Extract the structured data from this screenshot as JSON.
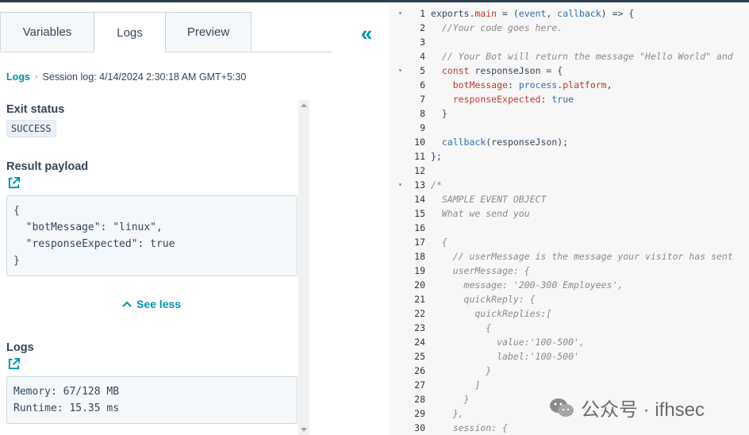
{
  "tabs": [
    {
      "label": "Variables"
    },
    {
      "label": "Logs"
    },
    {
      "label": "Preview"
    }
  ],
  "breadcrumb": {
    "link": "Logs",
    "current": "Session log: 4/14/2024 2:30:18 AM GMT+5:30"
  },
  "exit_status": {
    "heading": "Exit status",
    "value": "SUCCESS"
  },
  "result_payload": {
    "heading": "Result payload",
    "code": "{\n  \"botMessage\": \"linux\",\n  \"responseExpected\": true\n}"
  },
  "see_less": "See less",
  "logs_section": {
    "heading": "Logs",
    "code": "Memory: 67/128 MB\nRuntime: 15.35 ms"
  },
  "editor": {
    "lines": [
      {
        "n": "1",
        "fold": true
      },
      {
        "n": "2"
      },
      {
        "n": "3"
      },
      {
        "n": "4"
      },
      {
        "n": "5",
        "fold": true
      },
      {
        "n": "6"
      },
      {
        "n": "7"
      },
      {
        "n": "8"
      },
      {
        "n": "9"
      },
      {
        "n": "10"
      },
      {
        "n": "11"
      },
      {
        "n": "12"
      },
      {
        "n": "13",
        "fold": true
      },
      {
        "n": "14"
      },
      {
        "n": "15"
      },
      {
        "n": "16"
      },
      {
        "n": "17"
      },
      {
        "n": "18"
      },
      {
        "n": "19"
      },
      {
        "n": "20"
      },
      {
        "n": "21"
      },
      {
        "n": "22"
      },
      {
        "n": "23"
      },
      {
        "n": "24"
      },
      {
        "n": "25"
      },
      {
        "n": "26"
      },
      {
        "n": "27"
      },
      {
        "n": "28"
      },
      {
        "n": "29"
      },
      {
        "n": "30"
      }
    ],
    "code": [
      "exports.main = (event, callback) => {",
      "  //Your code goes here.",
      "",
      "  // Your Bot will return the message \"Hello World\" and",
      "  const responseJson = {",
      "    botMessage: process.platform,",
      "    responseExpected: true",
      "  }",
      "",
      "  callback(responseJson);",
      "};",
      "",
      "/*",
      "  SAMPLE EVENT OBJECT",
      "  What we send you",
      "",
      "  {",
      "    // userMessage is the message your visitor has sent",
      "    userMessage: {",
      "      message: '200-300 Employees',",
      "      quickReply: {",
      "        quickReplies:[",
      "          {",
      "            value:'100-500',",
      "            label:'100-500'",
      "          }",
      "        ]",
      "      }",
      "    },",
      "    session: {"
    ]
  },
  "watermark": "公众号 · ifhsec",
  "colors": {
    "accent": "#0091ae",
    "text": "#33475b"
  }
}
